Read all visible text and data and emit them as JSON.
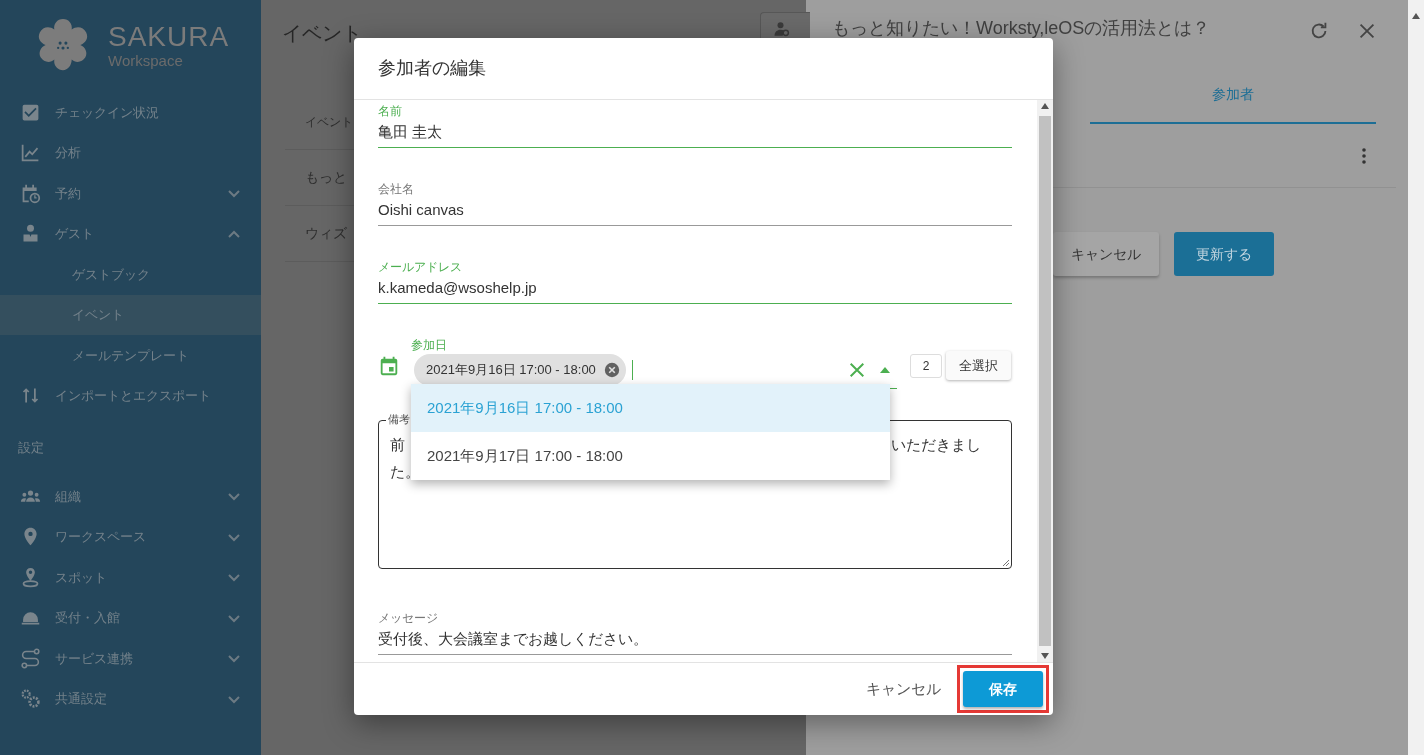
{
  "sidebar": {
    "logo": {
      "title": "SAKURA",
      "subtitle": "Workspace"
    },
    "items": [
      {
        "kind": "link",
        "label": "チェックイン状況",
        "selected": false
      },
      {
        "kind": "link",
        "label": "分析",
        "selected": false
      },
      {
        "kind": "group",
        "label": "予約",
        "expanded": false,
        "selected": false
      },
      {
        "kind": "group",
        "label": "ゲスト",
        "expanded": true,
        "selected": false,
        "children": [
          {
            "label": "ゲストブック",
            "selected": false
          },
          {
            "label": "イベント",
            "selected": true
          },
          {
            "label": "メールテンプレート",
            "selected": false
          }
        ]
      },
      {
        "kind": "link",
        "label": "インポートとエクスポート",
        "selected": false
      },
      {
        "kind": "section",
        "label": "設定"
      },
      {
        "kind": "group",
        "label": "組織",
        "expanded": false,
        "selected": false
      },
      {
        "kind": "group",
        "label": "ワークスペース",
        "expanded": false,
        "selected": false
      },
      {
        "kind": "group",
        "label": "スポット",
        "expanded": false,
        "selected": false
      },
      {
        "kind": "group",
        "label": "受付・入館",
        "expanded": false,
        "selected": false
      },
      {
        "kind": "group",
        "label": "サービス連携",
        "expanded": false,
        "selected": false
      },
      {
        "kind": "group",
        "label": "共通設定",
        "expanded": false,
        "selected": false
      }
    ]
  },
  "page": {
    "title": "イベント",
    "table": {
      "columns": [
        "イベント"
      ],
      "rows": [
        [
          "もっと"
        ],
        [
          "ウィズ"
        ]
      ]
    }
  },
  "detail_panel": {
    "title": "もっと知りたい！Worksty,leOSの活用法とは？",
    "tabs": [
      {
        "label": "参加者",
        "selected": true
      }
    ],
    "buttons": [
      {
        "label": "キャンセル",
        "kind": "secondary"
      },
      {
        "label": "更新する",
        "kind": "primary"
      }
    ]
  },
  "dialog": {
    "title": "参加者の編集",
    "fields": [
      {
        "kind": "text",
        "label": "名前",
        "value": "亀田 圭太",
        "valid": true
      },
      {
        "kind": "text",
        "label": "会社名",
        "value": "Oishi canvas",
        "valid": false
      },
      {
        "kind": "text",
        "label": "メールアドレス",
        "value": "k.kameda@wsoshelp.jp",
        "valid": true
      },
      {
        "kind": "chips",
        "label": "参加日",
        "chips": [
          "2021年9月16日 17:00 - 18:00"
        ],
        "count": "2",
        "select_all": "全選択",
        "expanded": true,
        "valid": true,
        "options": [
          {
            "label": "2021年9月16日 17:00 - 18:00",
            "selected": true
          },
          {
            "label": "2021年9月17日 17:00 - 18:00",
            "selected": false
          }
        ]
      },
      {
        "kind": "textarea",
        "label": "備考",
        "visible_text": [
          "前",
          "いただきまし",
          "た。"
        ]
      },
      {
        "kind": "text",
        "label": "メッセージ",
        "value": "受付後、大会議室までお越しください。",
        "valid": false
      }
    ],
    "footer": [
      {
        "label": "キャンセル",
        "kind": "text",
        "highlighted": false
      },
      {
        "label": "保存",
        "kind": "primary",
        "highlighted": true
      }
    ]
  }
}
